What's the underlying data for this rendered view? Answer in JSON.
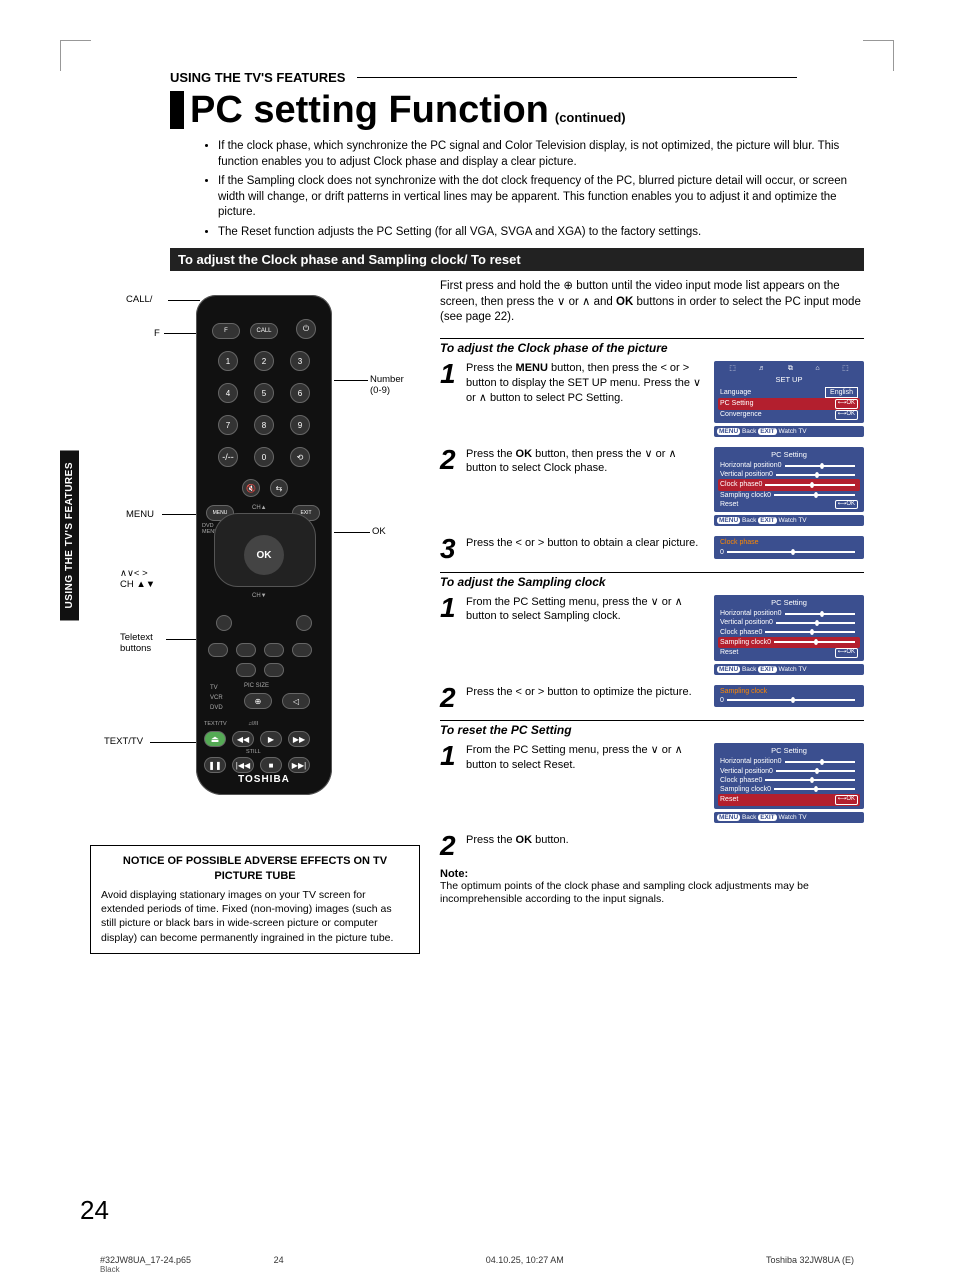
{
  "kicker": "USING THE TV'S FEATURES",
  "title": "PC setting Function",
  "title_suffix": "(continued)",
  "side_tab": "USING THE TV'S\nFEATURES",
  "bullets": [
    "If the clock phase, which synchronize the PC signal and Color Television display, is not optimized, the picture will blur.\nThis function enables you to adjust Clock phase and display a clear picture.",
    "If the Sampling clock does not synchronize with the dot clock frequency of the PC, blurred picture detail will occur, or screen width will change, or drift patterns in vertical lines may be apparent. This function enables you to adjust it and optimize the picture.",
    "The Reset function adjusts the PC Setting (for all VGA, SVGA and XGA) to the factory settings."
  ],
  "section_banner": "To adjust the Clock phase and Sampling clock/ To reset",
  "lead_parts": {
    "a": "First press and hold the ",
    "b": " button until the video input mode list appears on the screen, then press the ∨ or ∧ and ",
    "ok": "OK",
    "c": " buttons in order to select the PC input mode (see page 22)."
  },
  "sub1": "To adjust the Clock phase of the picture",
  "steps1": [
    {
      "n": "1",
      "text_parts": [
        "Press the ",
        "MENU",
        " button, then press the < or > button to display the SET UP menu. Press the ∨ or ∧ button to select PC Setting."
      ]
    },
    {
      "n": "2",
      "text_parts": [
        "Press the ",
        "OK",
        " button, then press the ∨ or ∧ button to select Clock phase."
      ]
    },
    {
      "n": "3",
      "text_parts": [
        "Press the < or > button to obtain a clear picture."
      ]
    }
  ],
  "sub2": "To adjust the Sampling clock",
  "steps2": [
    {
      "n": "1",
      "text_parts": [
        "From the PC Setting menu, press the ∨ or ∧ button to select Sampling clock."
      ]
    },
    {
      "n": "2",
      "text_parts": [
        "Press the < or > button to optimize the picture."
      ]
    }
  ],
  "sub3": "To reset the PC Setting",
  "steps3": [
    {
      "n": "1",
      "text_parts": [
        "From the PC Setting menu, press the ∨ or ∧ button to select Reset."
      ]
    },
    {
      "n": "2",
      "text_parts": [
        "Press the ",
        "OK",
        " button."
      ]
    }
  ],
  "note_heading": "Note:",
  "note_text": "The optimum points of the clock phase and sampling clock adjustments may be incomprehensible according to the input signals.",
  "osd_setup": {
    "title": "SET UP",
    "rows": [
      {
        "label": "Language",
        "value": "English",
        "boxed": true
      },
      {
        "label": "PC Setting",
        "sel": true,
        "ok": true
      },
      {
        "label": "Convergence",
        "ok": true
      }
    ],
    "footer": "MENU Back  EXIT Watch TV"
  },
  "osd_pc_clock": {
    "title": "PC Setting",
    "rows": [
      {
        "label": "Horizontal position",
        "val": "0",
        "slider": true
      },
      {
        "label": "Vertical position",
        "val": "0",
        "slider": true
      },
      {
        "label": "Clock phase",
        "val": "0",
        "slider": true,
        "sel": true
      },
      {
        "label": "Sampling clock",
        "val": "0",
        "slider": true
      },
      {
        "label": "Reset",
        "ok": true
      }
    ],
    "footer": "MENU Back  EXIT Watch TV"
  },
  "osd_bar_clock": {
    "label": "Clock phase",
    "val": "0"
  },
  "osd_pc_samp": {
    "title": "PC Setting",
    "rows": [
      {
        "label": "Horizontal position",
        "val": "0",
        "slider": true
      },
      {
        "label": "Vertical position",
        "val": "0",
        "slider": true
      },
      {
        "label": "Clock phase",
        "val": "0",
        "slider": true
      },
      {
        "label": "Sampling clock",
        "val": "0",
        "slider": true,
        "sel": true
      },
      {
        "label": "Reset",
        "ok": true
      }
    ],
    "footer": "MENU Back  EXIT Watch TV"
  },
  "osd_bar_samp": {
    "label": "Sampling clock",
    "val": "0"
  },
  "osd_pc_reset": {
    "title": "PC Setting",
    "rows": [
      {
        "label": "Horizontal position",
        "val": "0",
        "slider": true
      },
      {
        "label": "Vertical position",
        "val": "0",
        "slider": true
      },
      {
        "label": "Clock phase",
        "val": "0",
        "slider": true
      },
      {
        "label": "Sampling clock",
        "val": "0",
        "slider": true
      },
      {
        "label": "Reset",
        "sel": true,
        "ok": true
      }
    ],
    "footer": "MENU Back  EXIT Watch TV"
  },
  "remote_labels": {
    "call": "CALL/",
    "f": "F",
    "number": "Number\n(0-9)",
    "menu": "MENU",
    "ok": "OK",
    "arrows": "∧∨< >\nCH ▲▼",
    "teletext": "Teletext\nbuttons",
    "tv": "TV",
    "vcr": "VCR",
    "dvd": "DVD",
    "picsize": "PIC SIZE",
    "texttv": "TEXT/TV",
    "still": "STILL",
    "dvdmenu": "DVD\nMENU",
    "cha": "CH▲",
    "chv": "CH▼",
    "flabel": "F",
    "calllabel": "CALL",
    "brand": "TOSHIBA"
  },
  "notice": {
    "heading": "NOTICE OF POSSIBLE ADVERSE EFFECTS ON TV PICTURE TUBE",
    "body": "Avoid displaying stationary images on your TV screen for extended periods of time. Fixed (non-moving) images (such as still picture or black bars in wide-screen picture or computer display) can become permanently ingrained in the picture tube."
  },
  "page_number": "24",
  "footer": {
    "file": "#32JW8UA_17-24.p65",
    "page": "24",
    "date": "04.10.25, 10:27 AM",
    "model": "Toshiba 32JW8UA (E)",
    "black": "Black"
  }
}
